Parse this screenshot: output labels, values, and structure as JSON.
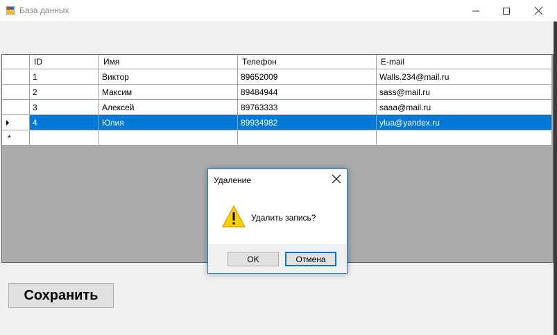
{
  "window": {
    "title": "База данных",
    "icon": "app-icon",
    "controls": [
      "minimize-icon",
      "maximize-icon",
      "close-icon"
    ]
  },
  "grid": {
    "columns": [
      "ID",
      "Имя",
      "Телефон",
      "E-mail"
    ],
    "rows": [
      {
        "id": "1",
        "name": "Виктор",
        "phone": "89652009",
        "email": "Walls.234@mail.ru"
      },
      {
        "id": "2",
        "name": "Максим",
        "phone": "89484944",
        "email": "sass@mail.ru"
      },
      {
        "id": "3",
        "name": "Алексей",
        "phone": "89763333",
        "email": "saaa@mail.ru"
      },
      {
        "id": "4",
        "name": "Юлия",
        "phone": "89934982",
        "email": "ylua@yandex.ru"
      }
    ],
    "selected_row": 3,
    "new_row_marker": "*"
  },
  "save_button": {
    "label": "Сохранить"
  },
  "dialog": {
    "title": "Удаление",
    "message": "Удалить запись?",
    "icon": "warning-icon",
    "ok_label": "OK",
    "cancel_label": "Отмена"
  },
  "colors": {
    "selection": "#0078d7",
    "form_background": "#f0f0f0",
    "grid_background": "#ababab",
    "dialog_border": "#1883d7"
  }
}
